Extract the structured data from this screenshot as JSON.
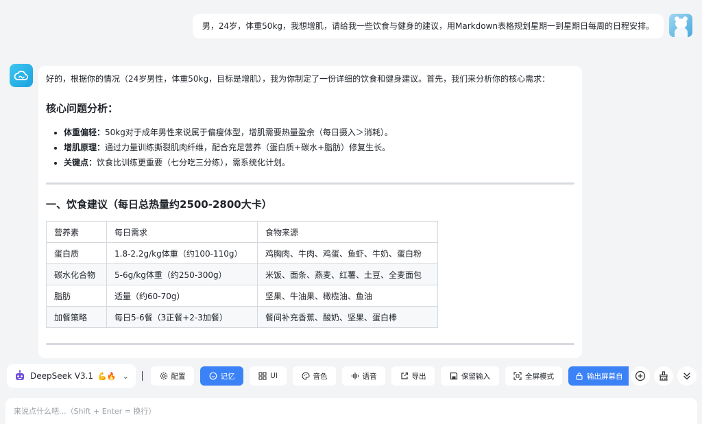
{
  "user_message": {
    "text": "男，24岁，体重50kg，我想增肌，请给我一些饮食与健身的建议，用Markdown表格规划星期一到星期日每周的日程安排。"
  },
  "assistant_message": {
    "intro": "好的，根据你的情况（24岁男性，体重50kg，目标是增肌），我为你制定了一份详细的饮食和健身建议。首先，我们来分析你的核心需求：",
    "analysis_title": "核心问题分析：",
    "points": [
      {
        "label": "体重偏轻：",
        "text": "50kg对于成年男性来说属于偏瘦体型，增肌需要热量盈余（每日摄入＞消耗）。"
      },
      {
        "label": "增肌原理：",
        "text": "通过力量训练撕裂肌肉纤维，配合充足营养（蛋白质+碳水+脂肪）修复生长。"
      },
      {
        "label": "关键点：",
        "text": "饮食比训练更重要（七分吃三分练），需系统化计划。"
      }
    ],
    "diet_title": "一、饮食建议（每日总热量约2500-2800大卡）",
    "table": {
      "headers": [
        "营养素",
        "每日需求",
        "食物来源"
      ],
      "rows": [
        [
          "蛋白质",
          "1.8-2.2g/kg体重（约100-110g）",
          "鸡胸肉、牛肉、鸡蛋、鱼虾、牛奶、蛋白粉"
        ],
        [
          "碳水化合物",
          "5-6g/kg体重（约250-300g）",
          "米饭、面条、燕麦、红薯、土豆、全麦面包"
        ],
        [
          "脂肪",
          "适量（约60-70g）",
          "坚果、牛油果、橄榄油、鱼油"
        ],
        [
          "加餐策略",
          "每日5-6餐（3正餐+2-3加餐）",
          "餐间补充香蕉、酸奶、坚果、蛋白棒"
        ]
      ]
    }
  },
  "toolbar": {
    "model_label": "DeepSeek V3.1",
    "model_emoji": "💪🔥",
    "buttons": {
      "config": "配置",
      "memory": "记忆",
      "ui": "UI",
      "voice_color": "音色",
      "speech": "语音",
      "export": "导出",
      "keep_input": "保留输入",
      "fullscreen": "全屏模式",
      "output_screen": "输出屏幕自"
    }
  },
  "input": {
    "placeholder": "来说点什么吧...（Shift + Enter = 换行）"
  },
  "colors": {
    "accent": "#3b82f6",
    "bot_avatar": "#1aa1e0",
    "background": "#f3f4f6"
  }
}
